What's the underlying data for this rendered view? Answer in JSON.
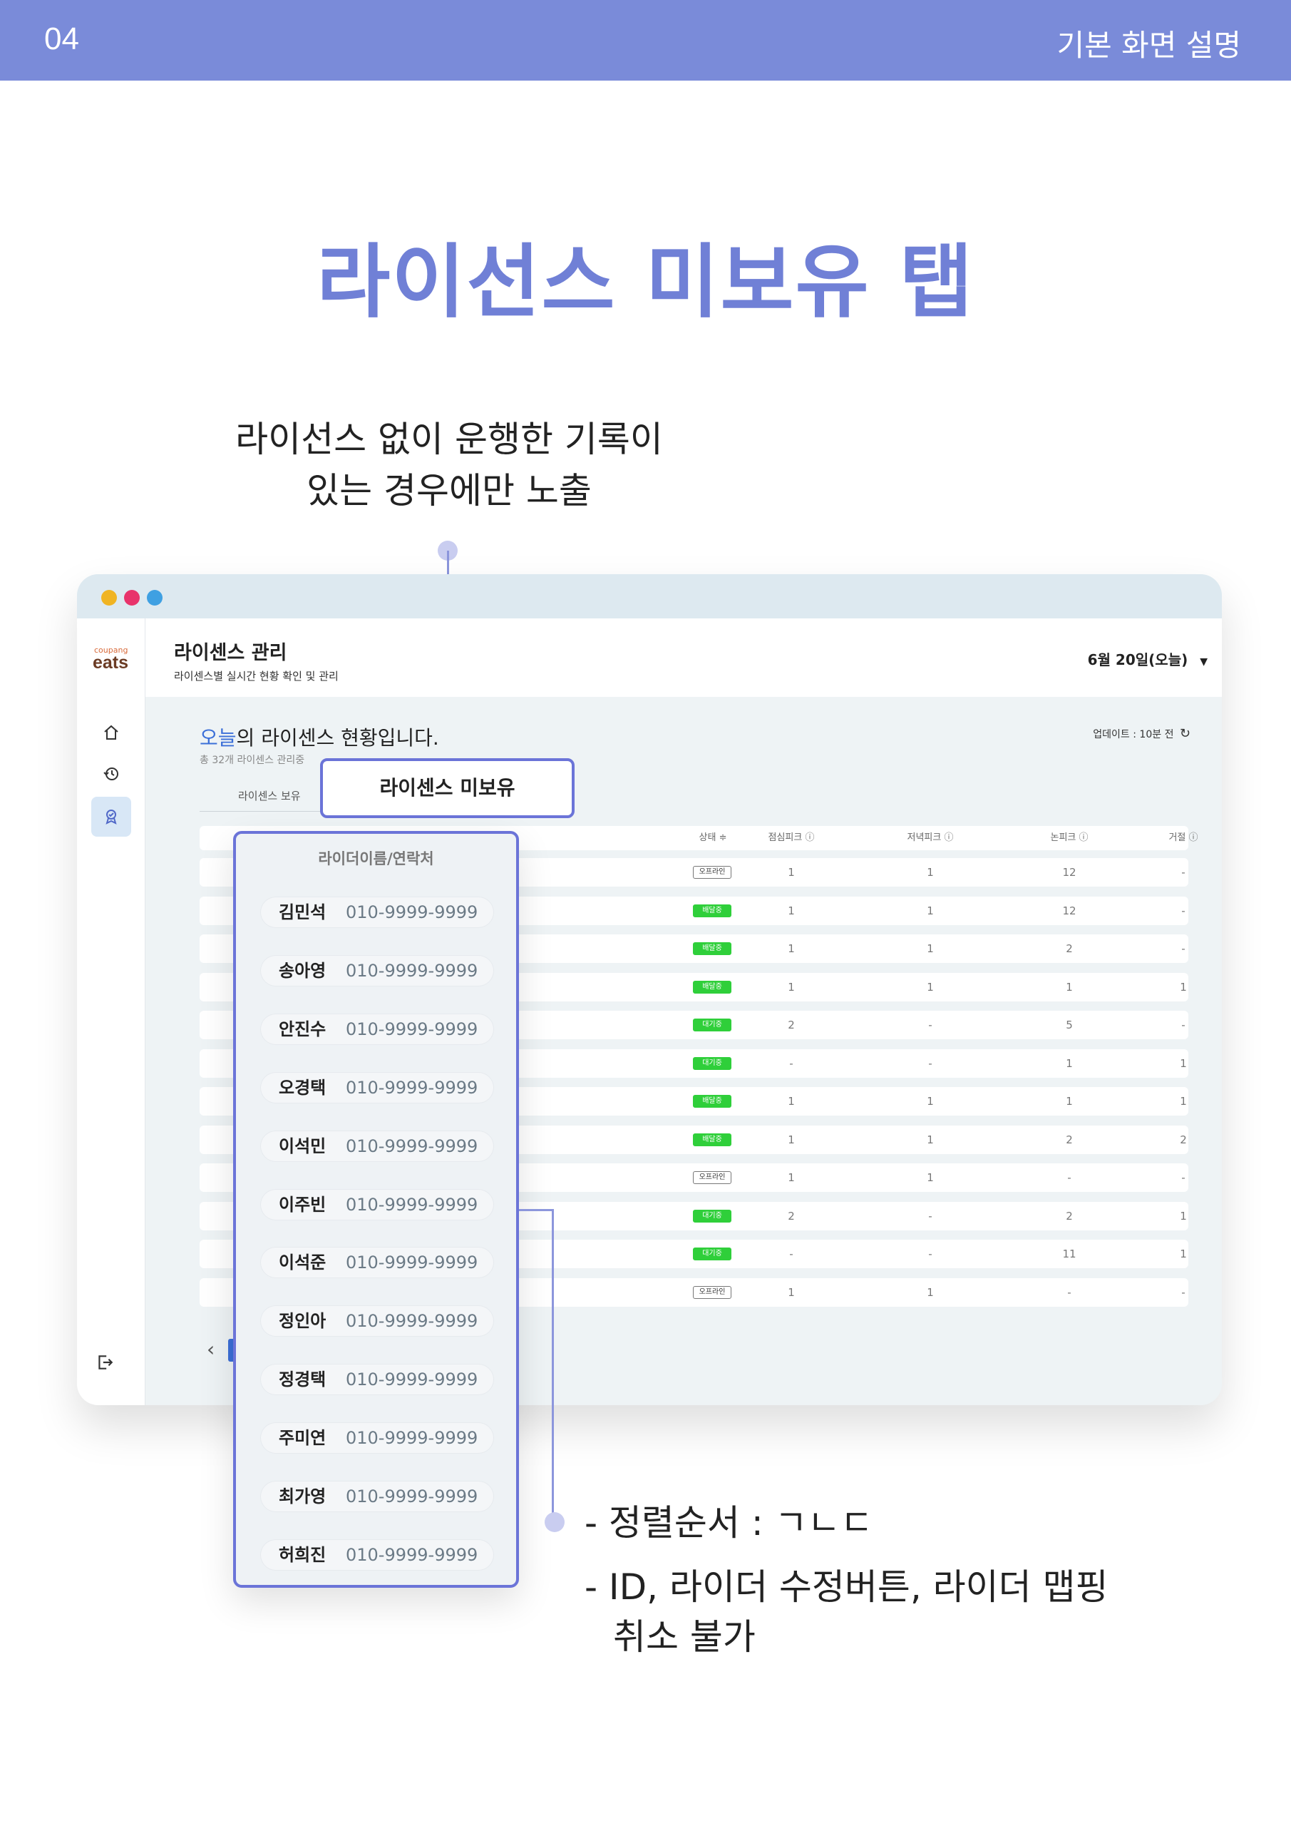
{
  "header": {
    "page_number": "04",
    "section": "기본 화면 설명"
  },
  "title": "라이선스 미보유 탭",
  "note_top": [
    "라이선스 없이 운행한 기록이",
    "있는 경우에만 노출"
  ],
  "app": {
    "logo_small": "coupang",
    "logo": "eats",
    "page_title": "라이센스 관리",
    "page_subtitle": "라이센스별 실시간 현황 확인 및 관리",
    "date_selector": "6월 20일(오늘)",
    "date_caret": "▼",
    "status_highlight": "오늘",
    "status_rest": "의 라이센스 현황입니다.",
    "status_sub": "총 32개 라이센스 관리중",
    "update_label": "업데이트 : 10분 전",
    "refresh_icon": "↻",
    "tab_owned": "라이센스 보유",
    "tab_unowned": "라이센스 미보유",
    "pager_prev": "‹",
    "colors": {
      "accent": "#6b74d8",
      "header_band": "#7a8bd9",
      "title": "#7080d6",
      "badge_green": "#2fcf3a"
    }
  },
  "table": {
    "columns": [
      "상태 ≑",
      "점심피크 ⓘ",
      "저녁피크 ⓘ",
      "논피크 ⓘ",
      "거절 ⓘ"
    ],
    "rows": [
      {
        "status": "오프라인",
        "type": "offline",
        "lunch": "1",
        "dinner": "1",
        "nonpeak": "12",
        "reject": "-"
      },
      {
        "status": "배달중",
        "type": "delivering",
        "lunch": "1",
        "dinner": "1",
        "nonpeak": "12",
        "reject": "-"
      },
      {
        "status": "배달중",
        "type": "delivering",
        "lunch": "1",
        "dinner": "1",
        "nonpeak": "2",
        "reject": "-"
      },
      {
        "status": "배달중",
        "type": "delivering",
        "lunch": "1",
        "dinner": "1",
        "nonpeak": "1",
        "reject": "1"
      },
      {
        "status": "대기중",
        "type": "waiting",
        "lunch": "2",
        "dinner": "-",
        "nonpeak": "5",
        "reject": "-"
      },
      {
        "status": "대기중",
        "type": "waiting",
        "lunch": "-",
        "dinner": "-",
        "nonpeak": "1",
        "reject": "1"
      },
      {
        "status": "배달중",
        "type": "delivering",
        "lunch": "1",
        "dinner": "1",
        "nonpeak": "1",
        "reject": "1"
      },
      {
        "status": "배달중",
        "type": "delivering",
        "lunch": "1",
        "dinner": "1",
        "nonpeak": "2",
        "reject": "2"
      },
      {
        "status": "오프라인",
        "type": "offline",
        "lunch": "1",
        "dinner": "1",
        "nonpeak": "-",
        "reject": "-"
      },
      {
        "status": "대기중",
        "type": "waiting",
        "lunch": "2",
        "dinner": "-",
        "nonpeak": "2",
        "reject": "1"
      },
      {
        "status": "대기중",
        "type": "waiting",
        "lunch": "-",
        "dinner": "-",
        "nonpeak": "11",
        "reject": "1"
      },
      {
        "status": "오프라인",
        "type": "offline",
        "lunch": "1",
        "dinner": "1",
        "nonpeak": "-",
        "reject": "-"
      }
    ]
  },
  "rider_panel": {
    "header": "라이더이름/연락처",
    "riders": [
      {
        "name": "김민석",
        "phone": "010-9999-9999"
      },
      {
        "name": "송아영",
        "phone": "010-9999-9999"
      },
      {
        "name": "안진수",
        "phone": "010-9999-9999"
      },
      {
        "name": "오경택",
        "phone": "010-9999-9999"
      },
      {
        "name": "이석민",
        "phone": "010-9999-9999"
      },
      {
        "name": "이주빈",
        "phone": "010-9999-9999"
      },
      {
        "name": "이석준",
        "phone": "010-9999-9999"
      },
      {
        "name": "정인아",
        "phone": "010-9999-9999"
      },
      {
        "name": "정경택",
        "phone": "010-9999-9999"
      },
      {
        "name": "주미연",
        "phone": "010-9999-9999"
      },
      {
        "name": "최가영",
        "phone": "010-9999-9999"
      },
      {
        "name": "허희진",
        "phone": "010-9999-9999"
      }
    ]
  },
  "note_bottom": [
    "- 정렬순서 : ㄱㄴㄷ",
    "- ID, 라이더 수정버튼, 라이더 맵핑",
    "취소 불가"
  ],
  "icons": {
    "home": "home-icon",
    "history": "history-icon",
    "license": "badge-icon",
    "logout": "logout-icon"
  }
}
